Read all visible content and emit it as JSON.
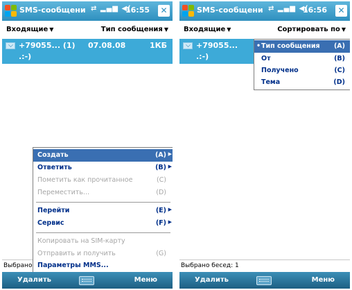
{
  "left": {
    "title": "SMS-сообщени",
    "time": "16:55",
    "folder": "Входящие",
    "sort_label": "Тип сообщения",
    "message": {
      "sender": "+79055...",
      "count": "(1)",
      "date": "07.08.08",
      "size": "1КБ",
      "preview": ".:-)"
    },
    "status": "Выбрано",
    "soft_left": "Удалить",
    "soft_right": "Меню",
    "menu": [
      {
        "label": "Создать",
        "key": "(A)",
        "submenu": true,
        "enabled": true,
        "selected": true
      },
      {
        "label": "Ответить",
        "key": "(B)",
        "submenu": true,
        "enabled": true
      },
      {
        "label": "Пометить как прочитанное",
        "key": "(C)",
        "submenu": false,
        "enabled": false
      },
      {
        "label": "Переместить...",
        "key": "(D)",
        "submenu": false,
        "enabled": false
      },
      {
        "label": "Перейти",
        "key": "(E)",
        "submenu": true,
        "enabled": true
      },
      {
        "label": "Сервис",
        "key": "(F)",
        "submenu": true,
        "enabled": true
      },
      {
        "label": "Копировать на SIM-карту",
        "key": "",
        "submenu": false,
        "enabled": false
      },
      {
        "label": "Отправить и получить",
        "key": "(G)",
        "submenu": false,
        "enabled": false
      },
      {
        "label": "Параметры MMS...",
        "key": "",
        "submenu": false,
        "enabled": true
      }
    ]
  },
  "right": {
    "title": "SMS-сообщени",
    "time": "16:56",
    "folder": "Входящие",
    "sort_label": "Сортировать по",
    "message": {
      "sender": "+79055...",
      "preview": ".:-)"
    },
    "status": "Выбрано бесед: 1",
    "soft_left": "Удалить",
    "soft_right": "Меню",
    "sort_menu": [
      {
        "label": "Тип сообщения",
        "key": "(A)",
        "selected": true
      },
      {
        "label": "От",
        "key": "(B)"
      },
      {
        "label": "Получено",
        "key": "(C)"
      },
      {
        "label": "Тема",
        "key": "(D)"
      }
    ]
  },
  "colors": {
    "titlebar": "#2e8fbe",
    "selection": "#3a6fb2",
    "message_highlight": "#3daad8",
    "menu_text": "#00308a"
  },
  "icons": [
    "windows-start-icon",
    "connectivity-icon",
    "signal-icon",
    "speaker-icon",
    "close-icon",
    "envelope-icon",
    "keyboard-icon"
  ]
}
